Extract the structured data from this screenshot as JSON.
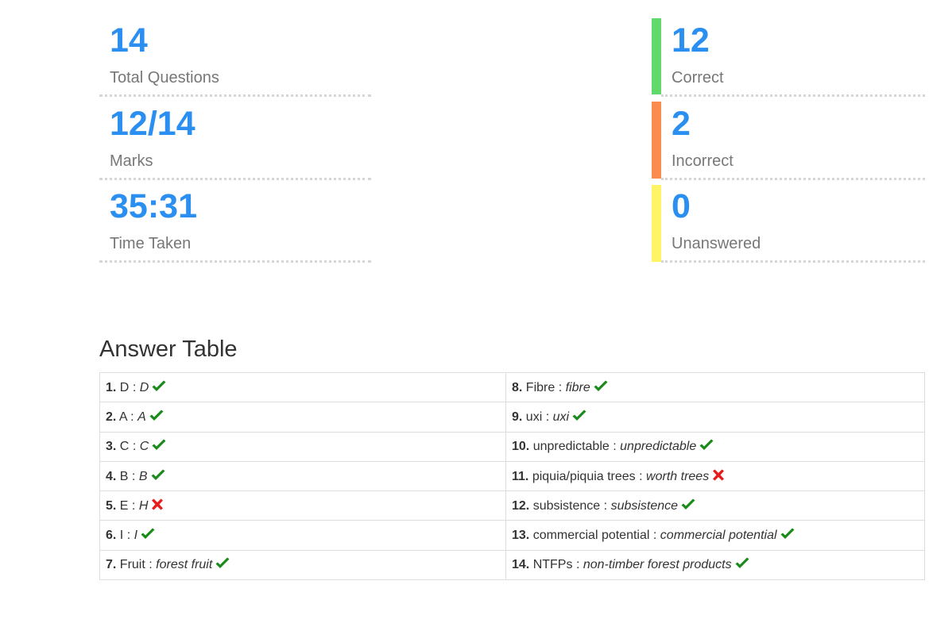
{
  "stats": {
    "total_questions": {
      "value": "14",
      "label": "Total Questions"
    },
    "marks": {
      "value": "12/14",
      "label": "Marks"
    },
    "time_taken": {
      "value": "35:31",
      "label": "Time Taken"
    },
    "correct": {
      "value": "12",
      "label": "Correct",
      "color": "#62d96b"
    },
    "incorrect": {
      "value": "2",
      "label": "Incorrect",
      "color": "#fb8c4f"
    },
    "unanswered": {
      "value": "0",
      "label": "Unanswered",
      "color": "#fff466"
    }
  },
  "answer_table": {
    "title": "Answer Table",
    "separator": ":",
    "rows": [
      {
        "num": "1.",
        "answer": "D",
        "response": "D",
        "status": "check-icon"
      },
      {
        "num": "2.",
        "answer": "A",
        "response": "A",
        "status": "check-icon"
      },
      {
        "num": "3.",
        "answer": "C",
        "response": "C",
        "status": "check-icon"
      },
      {
        "num": "4.",
        "answer": "B",
        "response": "B",
        "status": "check-icon"
      },
      {
        "num": "5.",
        "answer": "E",
        "response": "H",
        "status": "cross-icon"
      },
      {
        "num": "6.",
        "answer": "I",
        "response": "I",
        "status": "check-icon"
      },
      {
        "num": "7.",
        "answer": "Fruit",
        "response": "forest fruit",
        "status": "check-icon"
      },
      {
        "num": "8.",
        "answer": "Fibre",
        "response": "fibre",
        "status": "check-icon"
      },
      {
        "num": "9.",
        "answer": "uxi",
        "response": "uxi",
        "status": "check-icon"
      },
      {
        "num": "10.",
        "answer": "unpredictable",
        "response": "unpredictable",
        "status": "check-icon"
      },
      {
        "num": "11.",
        "answer": "piquia/piquia trees",
        "response": "worth trees",
        "status": "cross-icon"
      },
      {
        "num": "12.",
        "answer": "subsistence",
        "response": "subsistence",
        "status": "check-icon"
      },
      {
        "num": "13.",
        "answer": "commercial potential",
        "response": "commercial potential",
        "status": "check-icon"
      },
      {
        "num": "14.",
        "answer": "NTFPs",
        "response": "non-timber forest products",
        "status": "check-icon"
      }
    ]
  },
  "colors": {
    "value_blue": "#2a8ff0",
    "check_green": "#1a8a1a",
    "cross_red": "#e81c1c"
  }
}
